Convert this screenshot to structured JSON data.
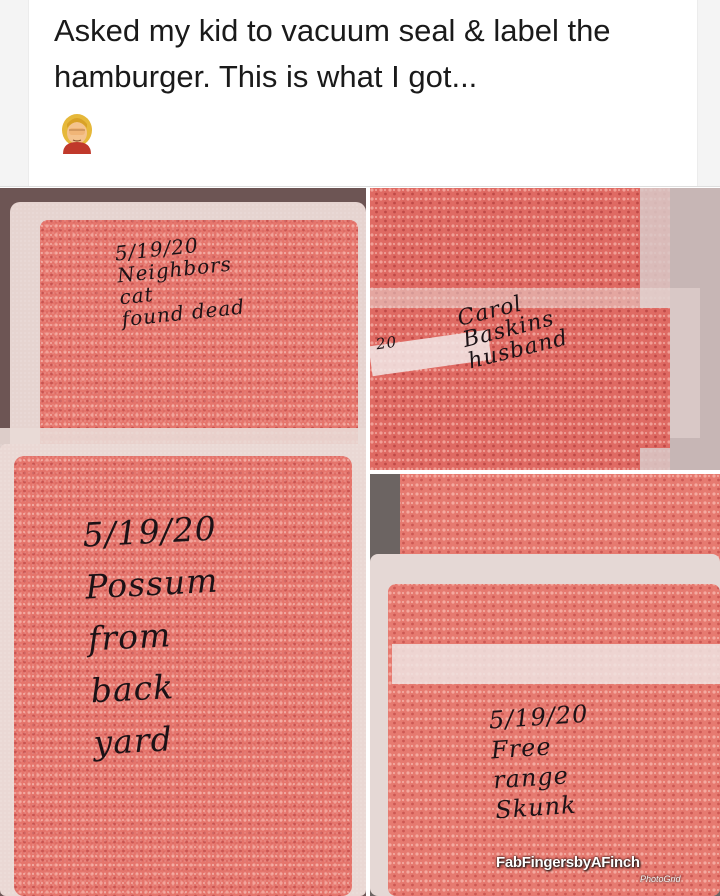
{
  "post": {
    "caption": "Asked my kid to vacuum seal & label the hamburger. This is what I got...",
    "reaction_icon": "woman-facepalming-emoji"
  },
  "photos": {
    "top_left": {
      "label_lines": [
        "5/19/20",
        "Neighbors",
        "cat",
        "found dead"
      ]
    },
    "top_right": {
      "side_label": "20",
      "label_lines": [
        "Carol",
        "Baskins",
        "husband"
      ]
    },
    "bottom_left": {
      "label_lines": [
        "5/19/20",
        "Possum",
        "from",
        "back",
        "yard"
      ]
    },
    "bottom_right": {
      "label_lines": [
        "5/19/20",
        "Free",
        "range",
        "Skunk"
      ]
    }
  },
  "watermark": {
    "text": "FabFingersbyAFinch",
    "sub": "PhotoGrid"
  },
  "colors": {
    "meat": "#e5756c",
    "meat_dark": "#c84e4a",
    "plastic": "#e9d6d2",
    "marker": "#1c1216"
  }
}
